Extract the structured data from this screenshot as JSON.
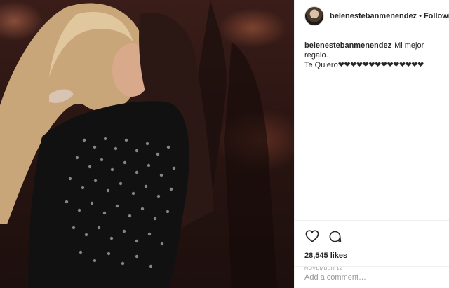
{
  "post": {
    "photo_icon": "photo-of-people-hugging"
  },
  "header": {
    "username": "belenestebanmenendez",
    "separator": "•",
    "follow_label": "Following",
    "avatar_icon": "avatar-icon"
  },
  "caption": {
    "username": "belenestebanmenendez",
    "text_line1": "Mi mejor regalo.",
    "text_line2": "Te Quiero",
    "hearts": "❤❤❤❤❤❤❤❤❤❤❤❤❤❤"
  },
  "actions": {
    "like_icon": "heart-outline-icon",
    "comment_icon": "comment-bubble-icon"
  },
  "likes": "28,545 likes",
  "date": "NOVEMBER 12",
  "comment": {
    "placeholder": "Add a comment…"
  },
  "colors": {
    "text": "#262626",
    "muted": "#999999",
    "divider": "#efefef"
  }
}
